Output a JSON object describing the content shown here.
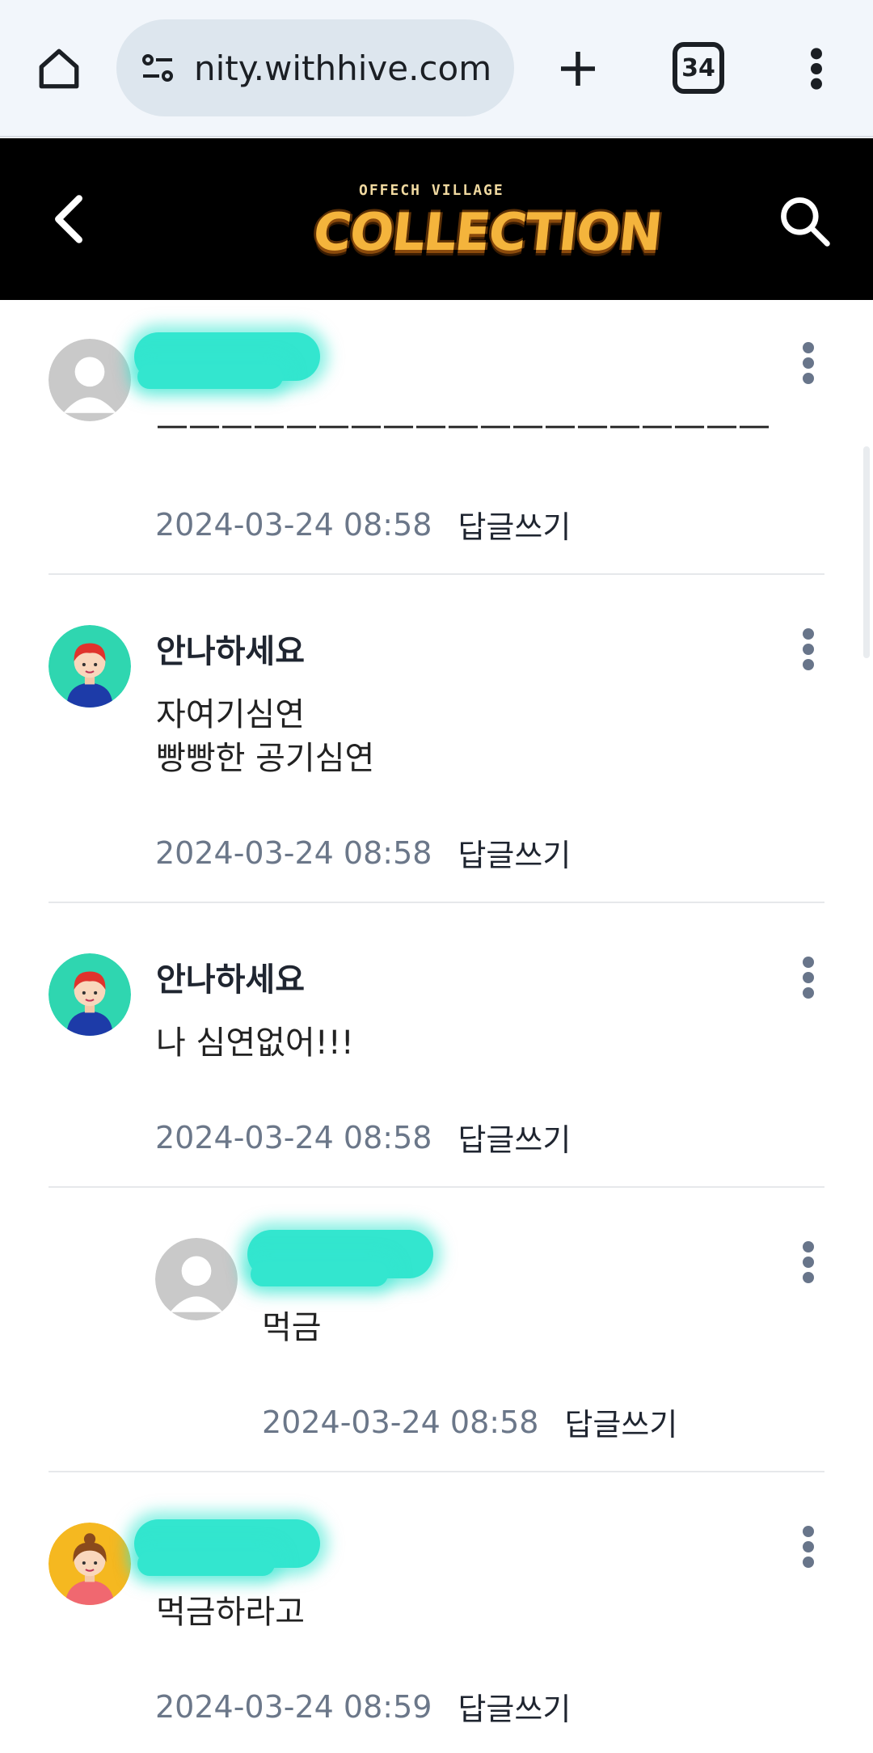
{
  "browser": {
    "url": "nity.withhive.com",
    "tab_count": "34"
  },
  "app": {
    "logo_small": "OFFECH VILLAGE",
    "logo_main": "COLLECTION"
  },
  "comments": [
    {
      "author": "",
      "redacted": true,
      "avatar": "default",
      "body": "———————————————————",
      "date": "2024-03-24 08:58",
      "reply_label": "답글쓰기",
      "is_reply": false
    },
    {
      "author": "안나하세요",
      "redacted": false,
      "avatar": "boy",
      "body": "자여기심연\n빵빵한 공기심연",
      "date": "2024-03-24 08:58",
      "reply_label": "답글쓰기",
      "is_reply": false
    },
    {
      "author": "안나하세요",
      "redacted": false,
      "avatar": "boy",
      "body": "나 심연없어!!!",
      "date": "2024-03-24 08:58",
      "reply_label": "답글쓰기",
      "is_reply": false
    },
    {
      "author": "",
      "redacted": true,
      "avatar": "default",
      "body": "먹금",
      "date": "2024-03-24 08:58",
      "reply_label": "답글쓰기",
      "is_reply": true
    },
    {
      "author": "",
      "redacted": true,
      "avatar": "girl",
      "body": "먹금하라고",
      "date": "2024-03-24 08:59",
      "reply_label": "답글쓰기",
      "is_reply": false
    }
  ],
  "colors": {
    "redaction": "#33e6cf",
    "date_text": "#6b7789",
    "header_bg": "#000000"
  }
}
